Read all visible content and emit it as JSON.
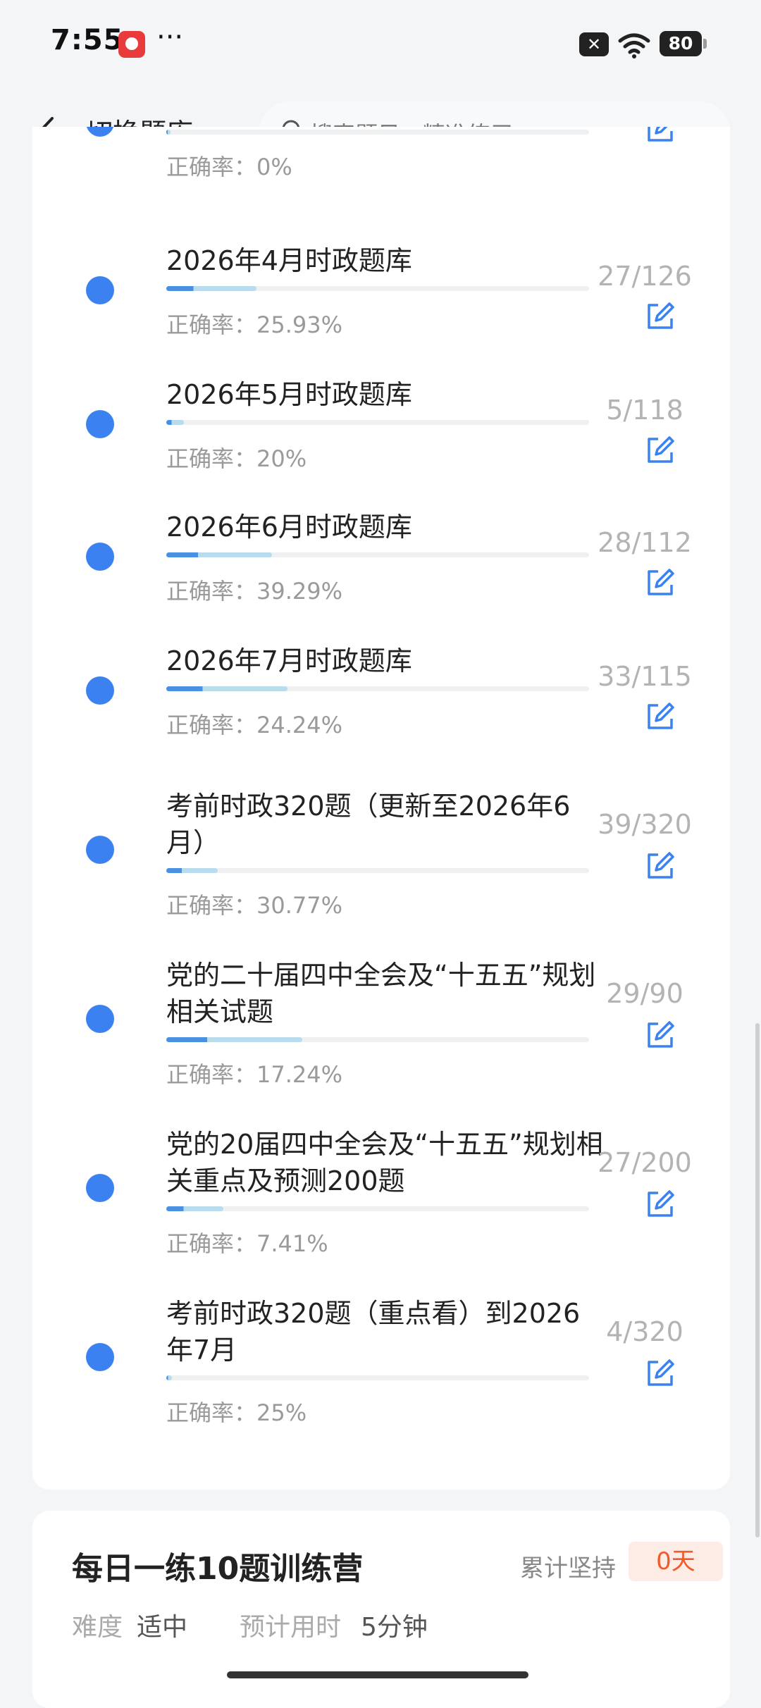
{
  "status_bar": {
    "time": "7:55",
    "dots": "···",
    "close_glyph": "✕",
    "battery": "80"
  },
  "header": {
    "switch_label": "切换题库",
    "search_placeholder": "搜索题目，精准练习"
  },
  "items": [
    {
      "title": "",
      "accuracy": "正确率：0%",
      "count": "",
      "progress": 0.01
    },
    {
      "title": "2026年4月时政题库",
      "accuracy": "正确率：25.93%",
      "count": "27/126",
      "progress": 0.214
    },
    {
      "title": "2026年5月时政题库",
      "accuracy": "正确率：20%",
      "count": "5/118",
      "progress": 0.042
    },
    {
      "title": "2026年6月时政题库",
      "accuracy": "正确率：39.29%",
      "count": "28/112",
      "progress": 0.25
    },
    {
      "title": "2026年7月时政题库",
      "accuracy": "正确率：24.24%",
      "count": "33/115",
      "progress": 0.287
    },
    {
      "title": "考前时政320题（更新至2026年6月）",
      "accuracy": "正确率：30.77%",
      "count": "39/320",
      "progress": 0.122
    },
    {
      "title": "党的二十届四中全会及“十五五”规划相关试题",
      "accuracy": "正确率：17.24%",
      "count": "29/90",
      "progress": 0.322
    },
    {
      "title": "党的20届四中全会及“十五五”规划相关重点及预测200题",
      "accuracy": "正确率：7.41%",
      "count": "27/200",
      "progress": 0.135
    },
    {
      "title": "考前时政320题（重点看）到2026年7月",
      "accuracy": "正确率：25%",
      "count": "4/320",
      "progress": 0.0125
    }
  ],
  "daily": {
    "title": "每日一练10题训练营",
    "streak_label": "累计坚持",
    "streak_value": "0天",
    "difficulty_label": "难度",
    "difficulty_value": "适中",
    "time_label": "预计用时",
    "time_value": "5分钟"
  }
}
